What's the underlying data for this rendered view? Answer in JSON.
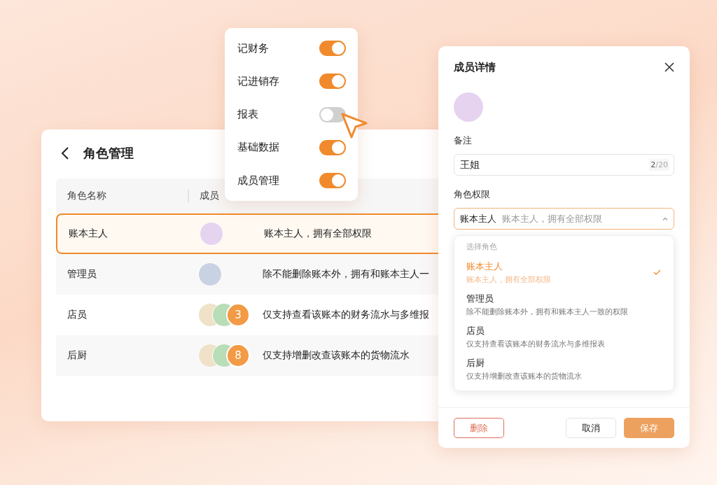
{
  "roles_card": {
    "title": "角色管理",
    "columns": [
      "角色名称",
      "成员"
    ],
    "rows": [
      {
        "name": "账本主人",
        "selected": true,
        "description": "账本主人，拥有全部权限"
      },
      {
        "name": "管理员",
        "selected": false,
        "description": "除不能删除账本外，拥有和账本主人一"
      },
      {
        "name": "店员",
        "selected": false,
        "member_badge": "3",
        "description": "仅支持查看该账本的财务流水与多维报"
      },
      {
        "name": "后厨",
        "selected": false,
        "member_badge": "8",
        "description": "仅支持增删改查该账本的货物流水"
      }
    ]
  },
  "permissions_popup": {
    "items": [
      {
        "label": "记财务",
        "on": true
      },
      {
        "label": "记进销存",
        "on": true
      },
      {
        "label": "报表",
        "on": false
      },
      {
        "label": "基础数据",
        "on": true
      },
      {
        "label": "成员管理",
        "on": true
      }
    ]
  },
  "member_panel": {
    "title": "成员详情",
    "note_label": "备注",
    "note_value": "王姐",
    "counter_current": "2",
    "counter_max": "/20",
    "role_label": "角色权限",
    "role_value": "账本主人",
    "role_hint": "账本主人，拥有全部权限",
    "expanded": true,
    "dropdown_heading": "选择角色",
    "options": [
      {
        "name": "账本主人",
        "description": "账本主人，拥有全部权限",
        "selected": true
      },
      {
        "name": "管理员",
        "description": "除不能删除账本外，拥有和账本主人一致的权限",
        "selected": false
      },
      {
        "name": "店员",
        "description": "仅支持查看该账本的财务流水与多维报表",
        "selected": false
      },
      {
        "name": "后厨",
        "description": "仅支持增删改查该账本的货物流水",
        "selected": false
      }
    ],
    "delete_button": "删除",
    "cancel_button": "取消",
    "save_button": "保存"
  }
}
